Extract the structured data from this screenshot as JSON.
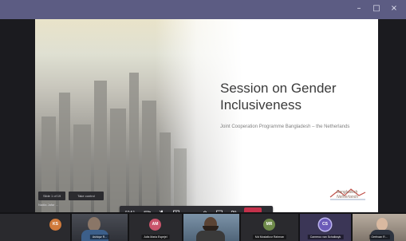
{
  "window": {
    "controls": [
      "–",
      "□",
      "×"
    ]
  },
  "slide": {
    "title": "Session on Gender Inclusiveness",
    "subtitle": "Joint Cooperation Programme Bangladesh – the Netherlands",
    "logo_text": "Bangladesh Netherlands"
  },
  "share": {
    "slide_counter": "Slide 1 of 19",
    "take_control": "Take control",
    "presenter": "Nadia Jafar ..."
  },
  "callbar": {
    "timer": "07:51",
    "buttons": [
      {
        "name": "camera-icon"
      },
      {
        "name": "microphone-icon"
      },
      {
        "name": "share-screen-icon"
      },
      {
        "name": "more-options-icon"
      },
      {
        "name": "raise-hand-icon"
      },
      {
        "name": "chat-icon"
      },
      {
        "name": "participants-icon"
      },
      {
        "name": "hang-up-icon"
      }
    ]
  },
  "gallery": {
    "tiles": [
      {
        "initials": "KS",
        "name": "",
        "color": "#d07a3b"
      },
      {
        "initials": "",
        "name": "Ashiqur R...",
        "color": "#3a3d46"
      },
      {
        "initials": "AM",
        "name": "Adis Maria Espejel",
        "color": "#c9546b"
      },
      {
        "initials": "",
        "name": "",
        "color": "#5b7a96"
      },
      {
        "initials": "MR",
        "name": "Md Mostafizur Rahman",
        "color": "#6e8a4a"
      },
      {
        "initials": "CS",
        "name": "Cameroo van Schalkwyk",
        "color": "#6b5bb8"
      },
      {
        "initials": "",
        "name": "Oerfroan R...",
        "color": "#8c7f73"
      }
    ]
  },
  "colors": {
    "titlebar": "#5c5c83",
    "hangup": "#c4314b",
    "app_icon": "#e26a1b"
  }
}
